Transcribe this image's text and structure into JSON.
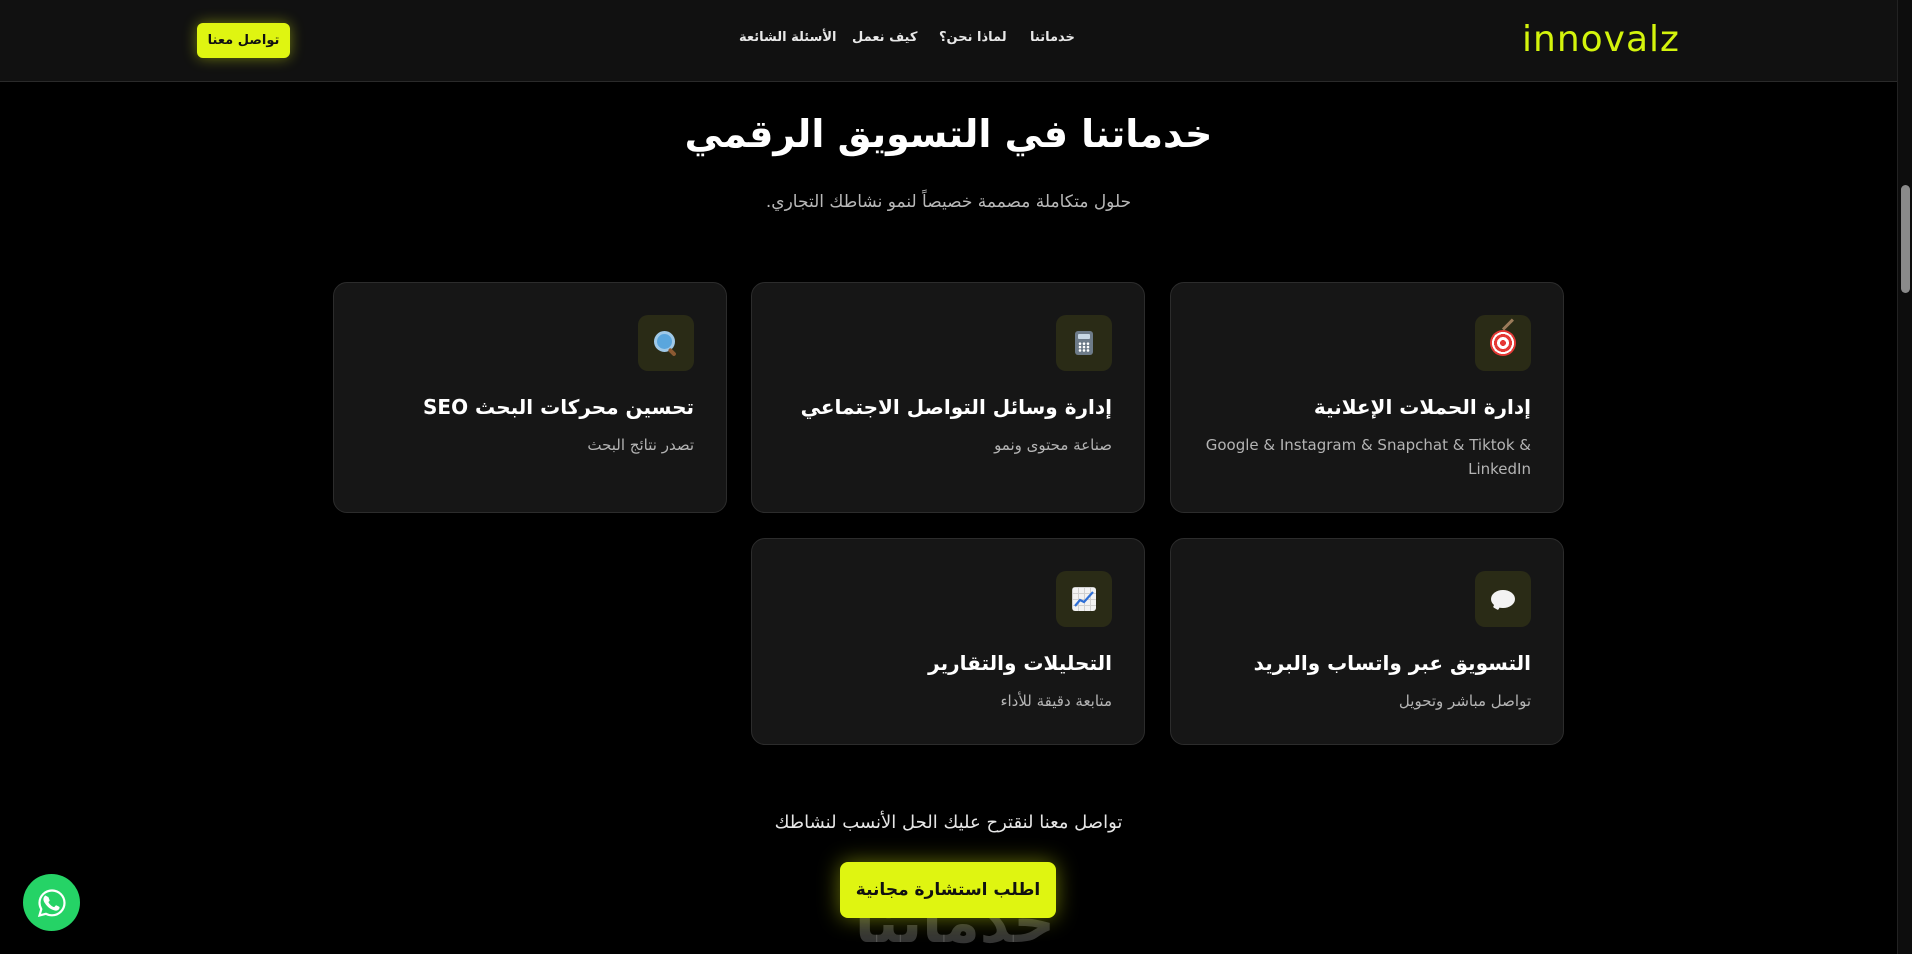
{
  "header": {
    "logo_text": "innovalz",
    "nav": [
      {
        "label": "خدماتنا"
      },
      {
        "label": "لماذا نحن؟"
      },
      {
        "label": "كيف نعمل"
      },
      {
        "label": "الأسئلة الشائعة"
      }
    ],
    "cta_label": "تواصل معنا"
  },
  "section": {
    "title": "خدماتنا في التسويق الرقمي",
    "subtitle": "حلول متكاملة مصممة خصيصاً لنمو نشاطك التجاري."
  },
  "services": [
    {
      "icon": "target-icon",
      "title": "إدارة الحملات الإعلانية",
      "description": "Google & Instagram & Snapchat & Tiktok & LinkedIn"
    },
    {
      "icon": "calculator-icon",
      "title": "إدارة وسائل التواصل الاجتماعي",
      "description": "صناعة محتوى ونمو"
    },
    {
      "icon": "magnifying-glass-icon",
      "title": "تحسين محركات البحث SEO",
      "description": "تصدر نتائج البحث"
    },
    {
      "icon": "speech-bubble-icon",
      "title": "التسويق عبر واتساب والبريد",
      "description": "تواصل مباشر وتحويل"
    },
    {
      "icon": "chart-increasing-icon",
      "title": "التحليلات والتقارير",
      "description": "متابعة دقيقة للأداء"
    }
  ],
  "cta": {
    "text": "تواصل معنا لنقترح عليك الحل الأنسب لنشاطك",
    "button_label": "اطلب استشارة مجانية",
    "watermark_text": "خدماتنا"
  },
  "colors": {
    "accent": "#dff511",
    "background": "#000000",
    "card": "#161616",
    "whatsapp": "#25d366"
  }
}
